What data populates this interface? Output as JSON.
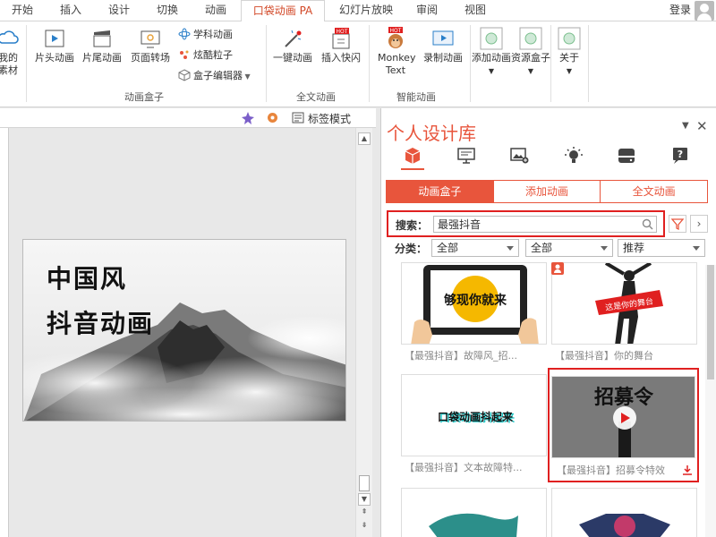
{
  "tabs": [
    "开始",
    "插入",
    "设计",
    "切换",
    "动画",
    "口袋动画 PA",
    "幻灯片放映",
    "审阅",
    "视图"
  ],
  "login_label": "登录",
  "ribbon": {
    "partial_left": [
      "我的",
      "素材"
    ],
    "anim_box": {
      "buttons": [
        "片头动画",
        "片尾动画",
        "页面转场"
      ],
      "small": [
        "学科动画",
        "炫酷粒子",
        "盒子编辑器"
      ],
      "label": "动画盒子"
    },
    "full_text": {
      "buttons": [
        "一键动画",
        "插入快闪"
      ],
      "label": "全文动画"
    },
    "smart": {
      "buttons": [
        "Monkey Text",
        "录制动画"
      ],
      "label": "智能动画",
      "hot": "HOT"
    },
    "extra": [
      "添加动画",
      "资源盒子",
      "关于"
    ]
  },
  "pane_toolbar": {
    "mode_label": "标签模式"
  },
  "slide": {
    "line1": "中国风",
    "line2": "抖音动画"
  },
  "panel": {
    "title": "个人设计库",
    "icon_names": [
      "box-icon",
      "slide-icon",
      "image-add-icon",
      "bulb-icon",
      "drive-icon",
      "help-icon"
    ],
    "subtabs": [
      "动画盒子",
      "添加动画",
      "全文动画"
    ],
    "search_label": "搜索：",
    "search_value": "最强抖音",
    "filter_label": "分类：",
    "filters": [
      "全部",
      "全部",
      "推荐"
    ],
    "cards": [
      {
        "caption": "【最强抖音】故障风_招..."
      },
      {
        "caption": "【最强抖音】你的舞台",
        "art": "这是你的舞台"
      },
      {
        "caption": "【最强抖音】文本故障特...",
        "art": "口袋动画抖起来"
      },
      {
        "caption": "【最强抖音】招募令特效",
        "art": "招募令"
      }
    ],
    "tablet_text": "够现你就来"
  },
  "colors": {
    "accent": "#e8553c",
    "highlight": "#e02020"
  }
}
